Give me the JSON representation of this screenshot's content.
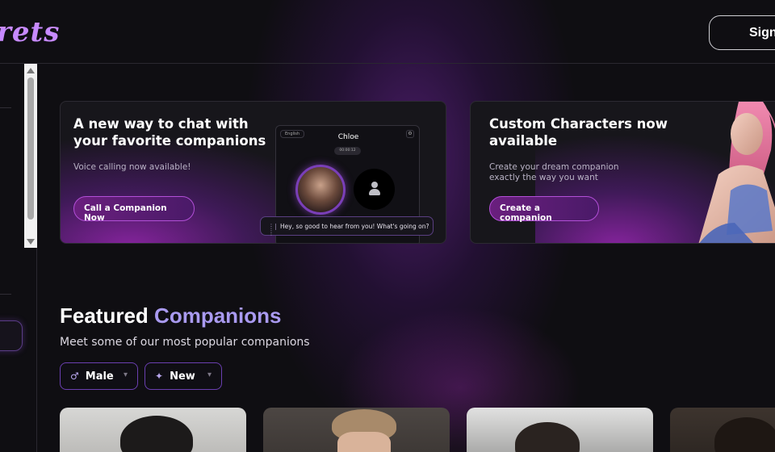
{
  "header": {
    "logo_text": "rets",
    "signin_label": "Sign"
  },
  "banners": [
    {
      "title": "A new way to chat with your favorite companions",
      "subtitle": "Voice calling now available!",
      "button_label": "Call a Companion Now",
      "mock": {
        "language": "English",
        "name": "Chloe",
        "timer": "00:00:12",
        "message": "Hey, so good to hear from you! What's going on?"
      }
    },
    {
      "title": "Custom Characters now available",
      "subtitle": "Create your dream companion exactly the way you want",
      "button_label": "Create a companion"
    }
  ],
  "featured": {
    "title_main": "Featured",
    "title_accent": "Companions",
    "subtitle": "Meet some of our most popular companions",
    "filters": [
      {
        "icon": "male-icon",
        "glyph": "♂",
        "label": "Male"
      },
      {
        "icon": "sparkle-icon",
        "glyph": "✦",
        "label": "New"
      }
    ]
  },
  "colors": {
    "background": "#0f0e12",
    "accent": "#a99af0",
    "button_border": "#b34fd8",
    "logo": "#c78aff"
  }
}
